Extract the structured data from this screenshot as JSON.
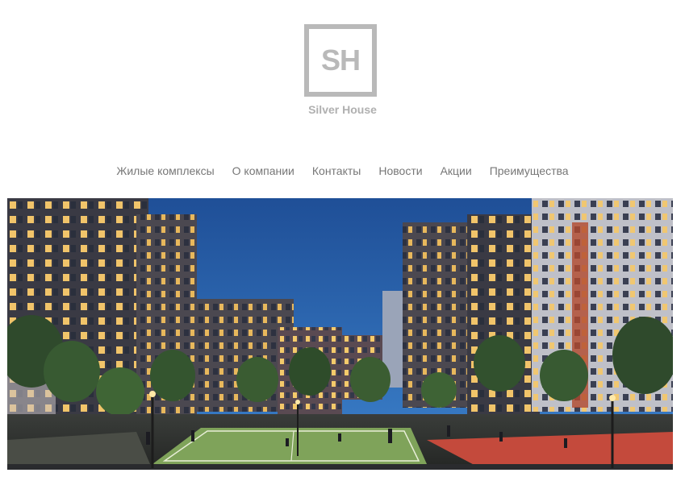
{
  "logo": {
    "mark": "SH",
    "name": "Silver House"
  },
  "nav": {
    "items": [
      {
        "label": "Жилые комплексы"
      },
      {
        "label": "О компании"
      },
      {
        "label": "Контакты"
      },
      {
        "label": "Новости"
      },
      {
        "label": "Акции"
      },
      {
        "label": "Преимущества"
      }
    ]
  },
  "colors": {
    "logo_gray": "#b9b9b9",
    "nav_text": "#777777",
    "sky_top": "#1f4f97",
    "sky_bottom": "#3c82cc",
    "window_light": "#f3c96a",
    "court_green": "#7fa35a"
  },
  "hero": {
    "image": "night residential complex courtyard illustration"
  }
}
